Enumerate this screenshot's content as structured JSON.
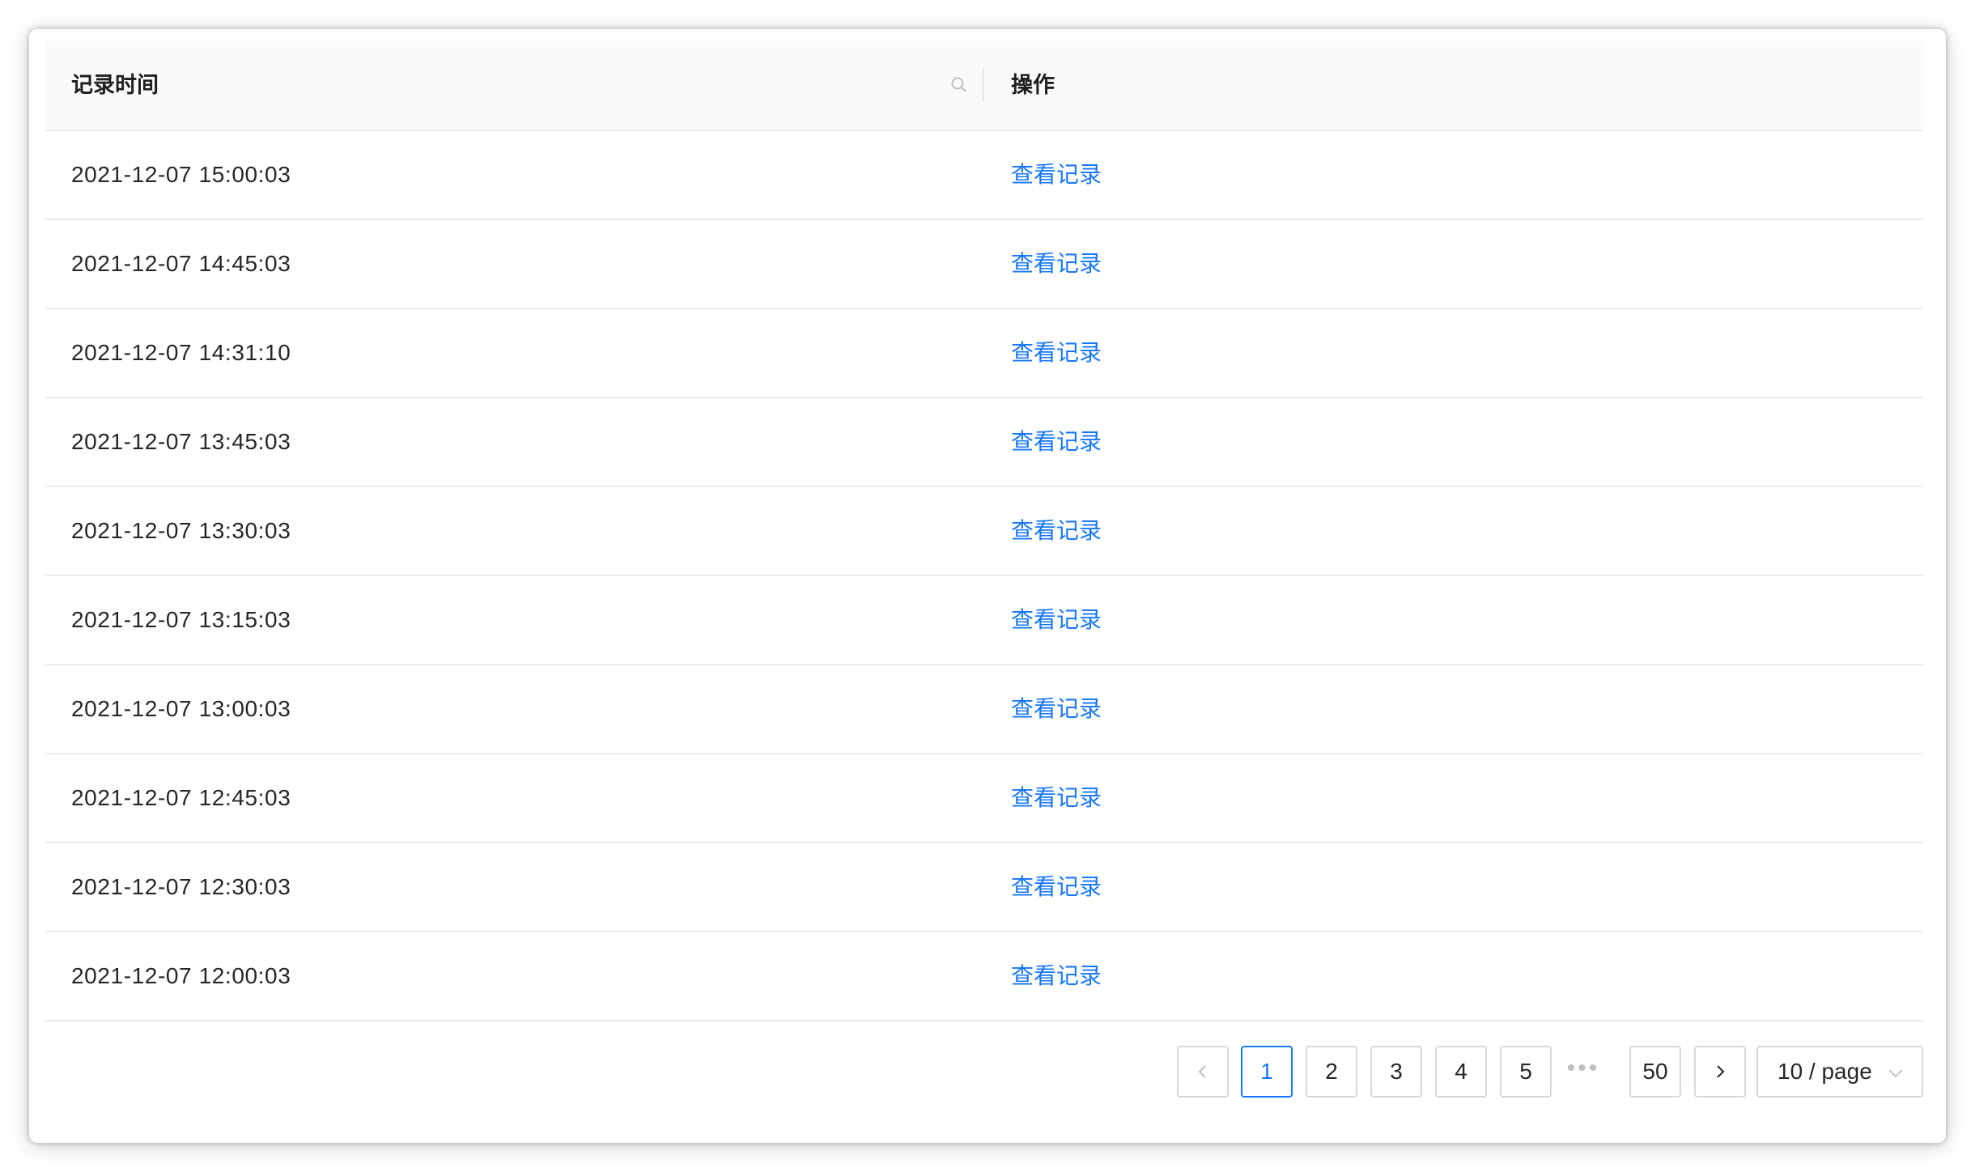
{
  "table": {
    "columns": {
      "time": "记录时间",
      "action": "操作"
    },
    "rows": [
      {
        "time": "2021-12-07 15:00:03",
        "action": "查看记录"
      },
      {
        "time": "2021-12-07 14:45:03",
        "action": "查看记录"
      },
      {
        "time": "2021-12-07 14:31:10",
        "action": "查看记录"
      },
      {
        "time": "2021-12-07 13:45:03",
        "action": "查看记录"
      },
      {
        "time": "2021-12-07 13:30:03",
        "action": "查看记录"
      },
      {
        "time": "2021-12-07 13:15:03",
        "action": "查看记录"
      },
      {
        "time": "2021-12-07 13:00:03",
        "action": "查看记录"
      },
      {
        "time": "2021-12-07 12:45:03",
        "action": "查看记录"
      },
      {
        "time": "2021-12-07 12:30:03",
        "action": "查看记录"
      },
      {
        "time": "2021-12-07 12:00:03",
        "action": "查看记录"
      }
    ]
  },
  "pagination": {
    "pages": [
      "1",
      "2",
      "3",
      "4",
      "5"
    ],
    "current": "1",
    "ellipsis": "•••",
    "last_page": "50",
    "page_size": "10 / page"
  },
  "icons": {
    "column_search": "search-icon",
    "prev": "chevron-left-icon",
    "next": "chevron-right-icon",
    "size_dropdown": "chevron-down-icon"
  },
  "colors": {
    "link": "#1677ff",
    "header_bg": "#fafafa",
    "border": "#ebebeb",
    "text": "#262626"
  }
}
